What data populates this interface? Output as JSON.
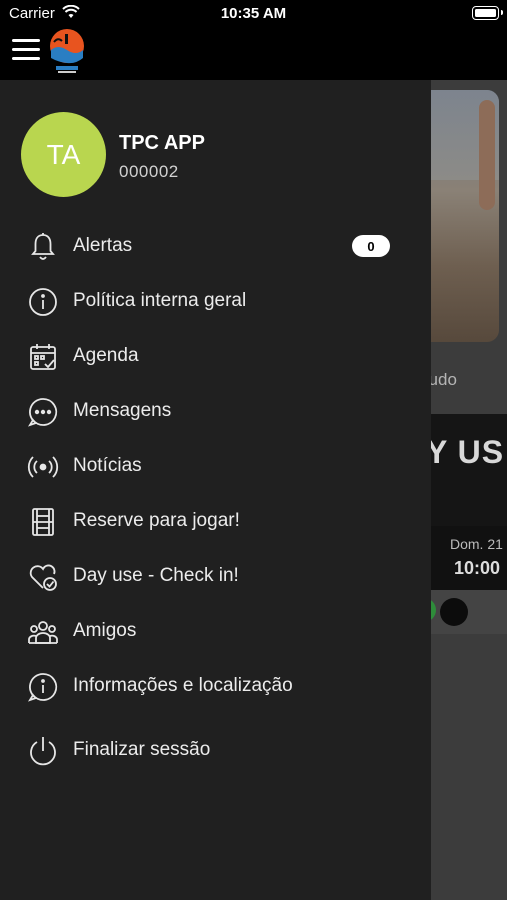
{
  "status_bar": {
    "carrier": "Carrier",
    "time": "10:35 AM"
  },
  "profile": {
    "initials": "TA",
    "name": "TPC APP",
    "id": "000002"
  },
  "menu": [
    {
      "label": "Alertas",
      "icon": "bell-icon",
      "badge": "0"
    },
    {
      "label": "Política interna geral",
      "icon": "info-icon"
    },
    {
      "label": "Agenda",
      "icon": "calendar-icon"
    },
    {
      "label": "Mensagens",
      "icon": "chat-icon"
    },
    {
      "label": "Notícias",
      "icon": "broadcast-icon"
    },
    {
      "label": "Reserve para jogar!",
      "icon": "court-icon"
    },
    {
      "label": "Day use - Check in!",
      "icon": "heart-check-icon"
    },
    {
      "label": "Amigos",
      "icon": "friends-icon"
    },
    {
      "label": "Informações e localização",
      "icon": "info-bubble-icon"
    },
    {
      "label": "Finalizar sessão",
      "icon": "power-icon"
    }
  ],
  "background": {
    "see_all": "er tudo",
    "card_title": "Y US",
    "date_label": "Dom. 21",
    "date_time": "10:00"
  },
  "colors": {
    "avatar": "#b9d64f",
    "drawer": "#202020"
  }
}
